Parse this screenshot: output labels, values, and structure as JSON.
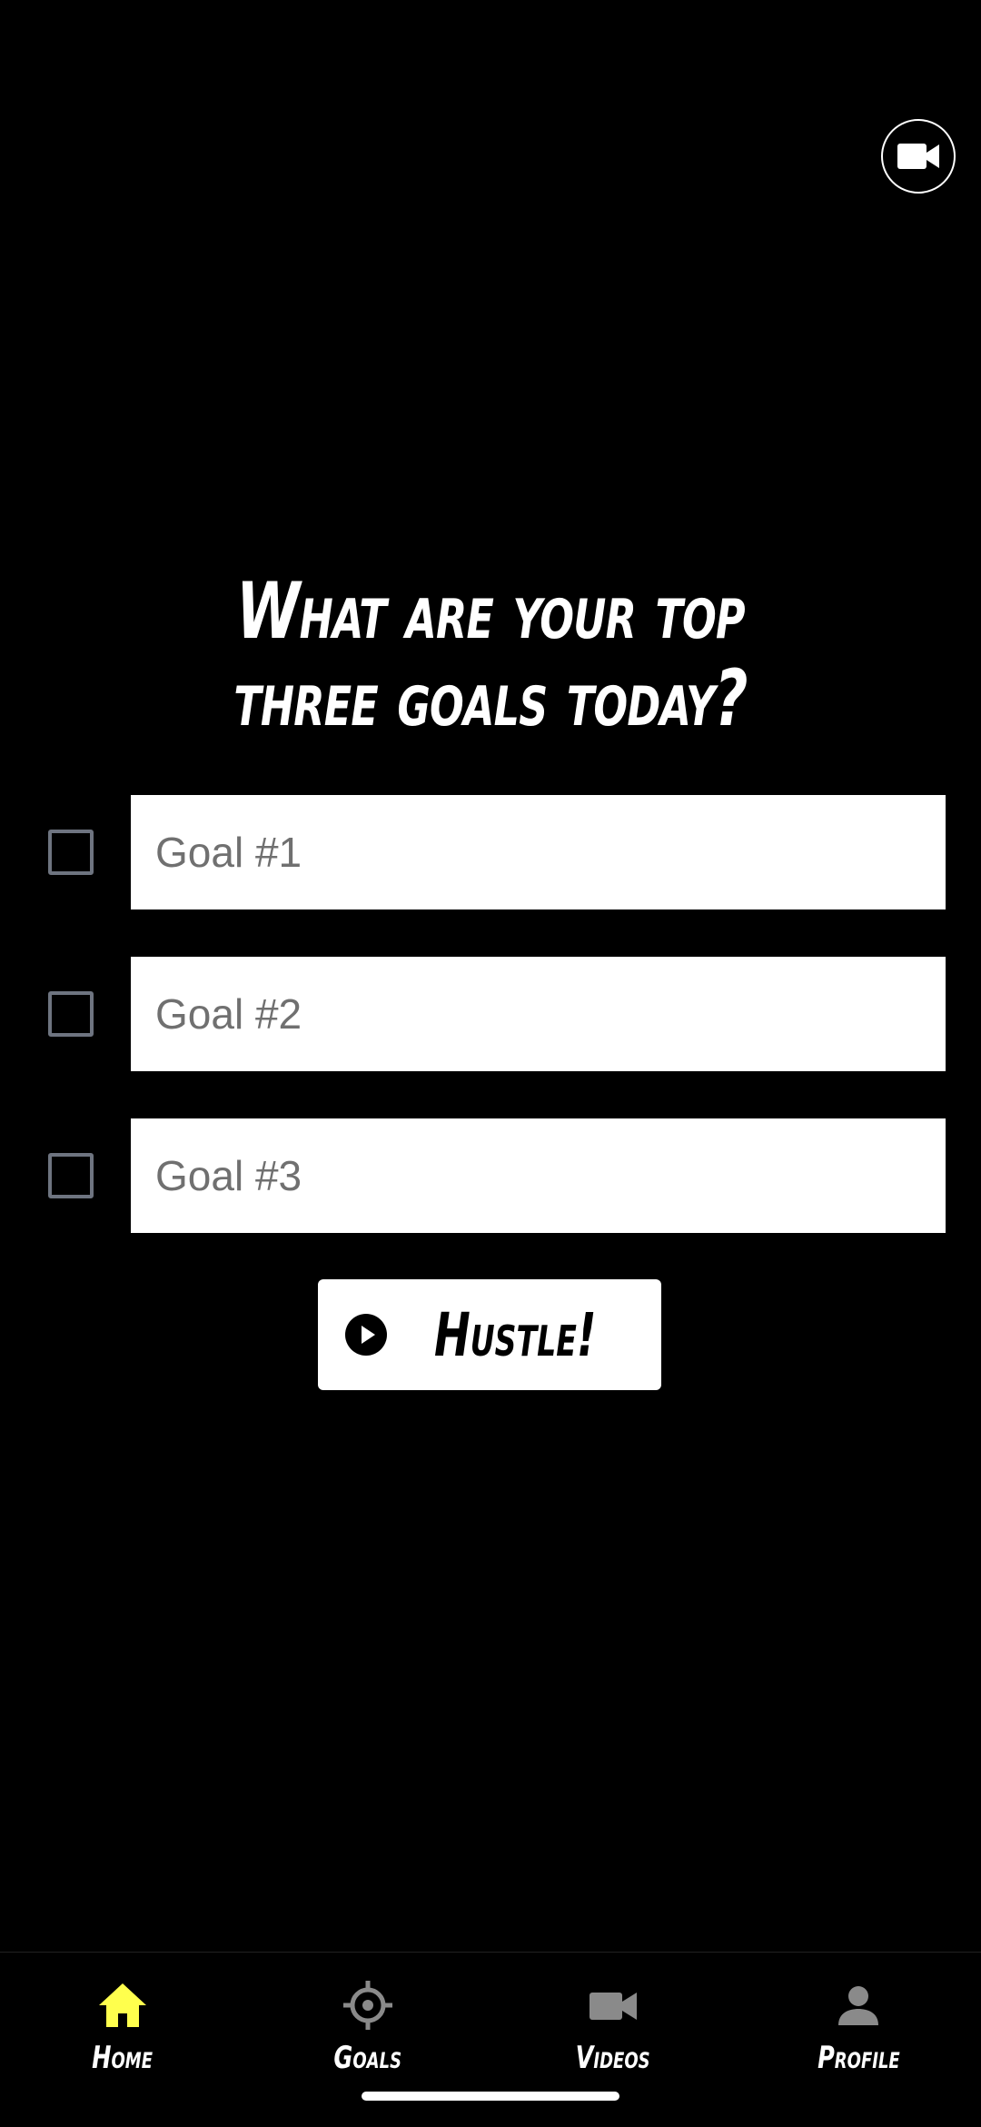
{
  "header": {
    "video_icon": "video-camera-icon"
  },
  "prompt": {
    "line1": "What are your top",
    "line2": "three goals today?"
  },
  "goals": [
    {
      "placeholder": "Goal #1",
      "value": "",
      "checked": false
    },
    {
      "placeholder": "Goal #2",
      "value": "",
      "checked": false
    },
    {
      "placeholder": "Goal #3",
      "value": "",
      "checked": false
    }
  ],
  "hustle_button": {
    "label": "Hustle!",
    "icon": "play-circle-icon"
  },
  "nav": {
    "items": [
      {
        "label": "Home",
        "icon": "home-icon",
        "active": true
      },
      {
        "label": "Goals",
        "icon": "crosshair-icon",
        "active": false
      },
      {
        "label": "Videos",
        "icon": "video-camera-icon",
        "active": false
      },
      {
        "label": "Profile",
        "icon": "person-icon",
        "active": false
      }
    ]
  },
  "colors": {
    "background": "#000000",
    "accent": "#FFFF4D",
    "inactive_icon": "#8A8A8A",
    "checkbox_border": "#6E7480"
  }
}
